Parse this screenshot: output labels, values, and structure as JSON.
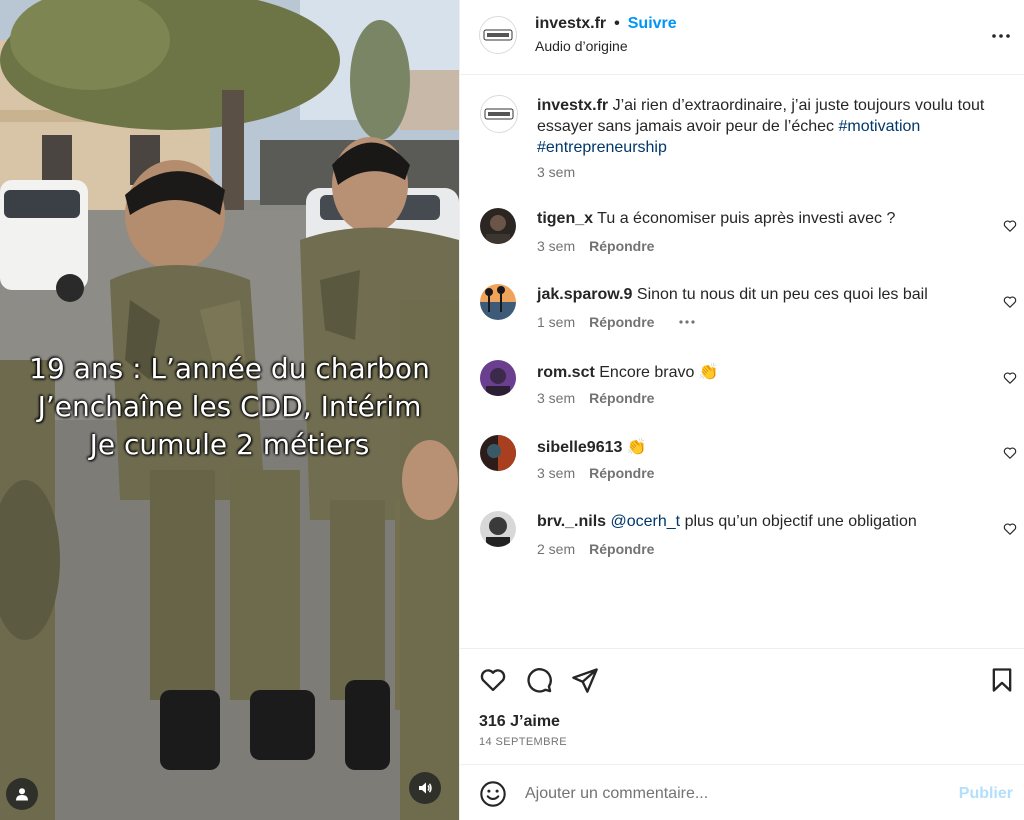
{
  "media": {
    "overlay_lines": [
      "19 ans : L’année du charbon",
      "J’enchaîne les CDD, Intérim",
      "Je cumule 2 métiers"
    ],
    "user_icon": "user-icon",
    "audio_icon": "speaker-icon"
  },
  "header": {
    "username": "investx.fr",
    "separator": "•",
    "follow_label": "Suivre",
    "audio_label": "Audio d’origine",
    "more_icon": "more-options-icon"
  },
  "caption": {
    "username": "investx.fr",
    "text": " J’ai rien d’extraordinaire, j’ai juste toujours voulu tout essayer sans jamais avoir peur de l’échec ",
    "hashtags": [
      "#motivation",
      "#entrepreneurship"
    ],
    "time": "3 sem"
  },
  "comments": [
    {
      "username": "tigen_x",
      "text": "Tu a économiser puis après investi avec ?",
      "time": "3 sem",
      "reply": "Répondre",
      "more": false
    },
    {
      "username": "jak.sparow.9",
      "text": "Sinon tu nous dit un peu ces quoi les bail",
      "time": "1 sem",
      "reply": "Répondre",
      "more": true
    },
    {
      "username": "rom.sct",
      "text": "Encore bravo 👏",
      "time": "3 sem",
      "reply": "Répondre",
      "more": false
    },
    {
      "username": "sibelle9613",
      "text": "👏",
      "time": "3 sem",
      "reply": "Répondre",
      "more": false
    },
    {
      "username": "brv._.nils",
      "mention": "@ocerh_t",
      "text": " plus qu’un objectif une obligation",
      "time": "2 sem",
      "reply": "Répondre",
      "more": false
    }
  ],
  "actions": {
    "likes": "316 J’aime",
    "date": "14 SEPTEMBRE"
  },
  "add_comment": {
    "placeholder": "Ajouter un commentaire...",
    "publish_label": "Publier"
  },
  "colors": {
    "accent": "#0095f6",
    "hashtag": "#00376b",
    "muted": "#737373",
    "publish_disabled": "#b2dffc"
  }
}
